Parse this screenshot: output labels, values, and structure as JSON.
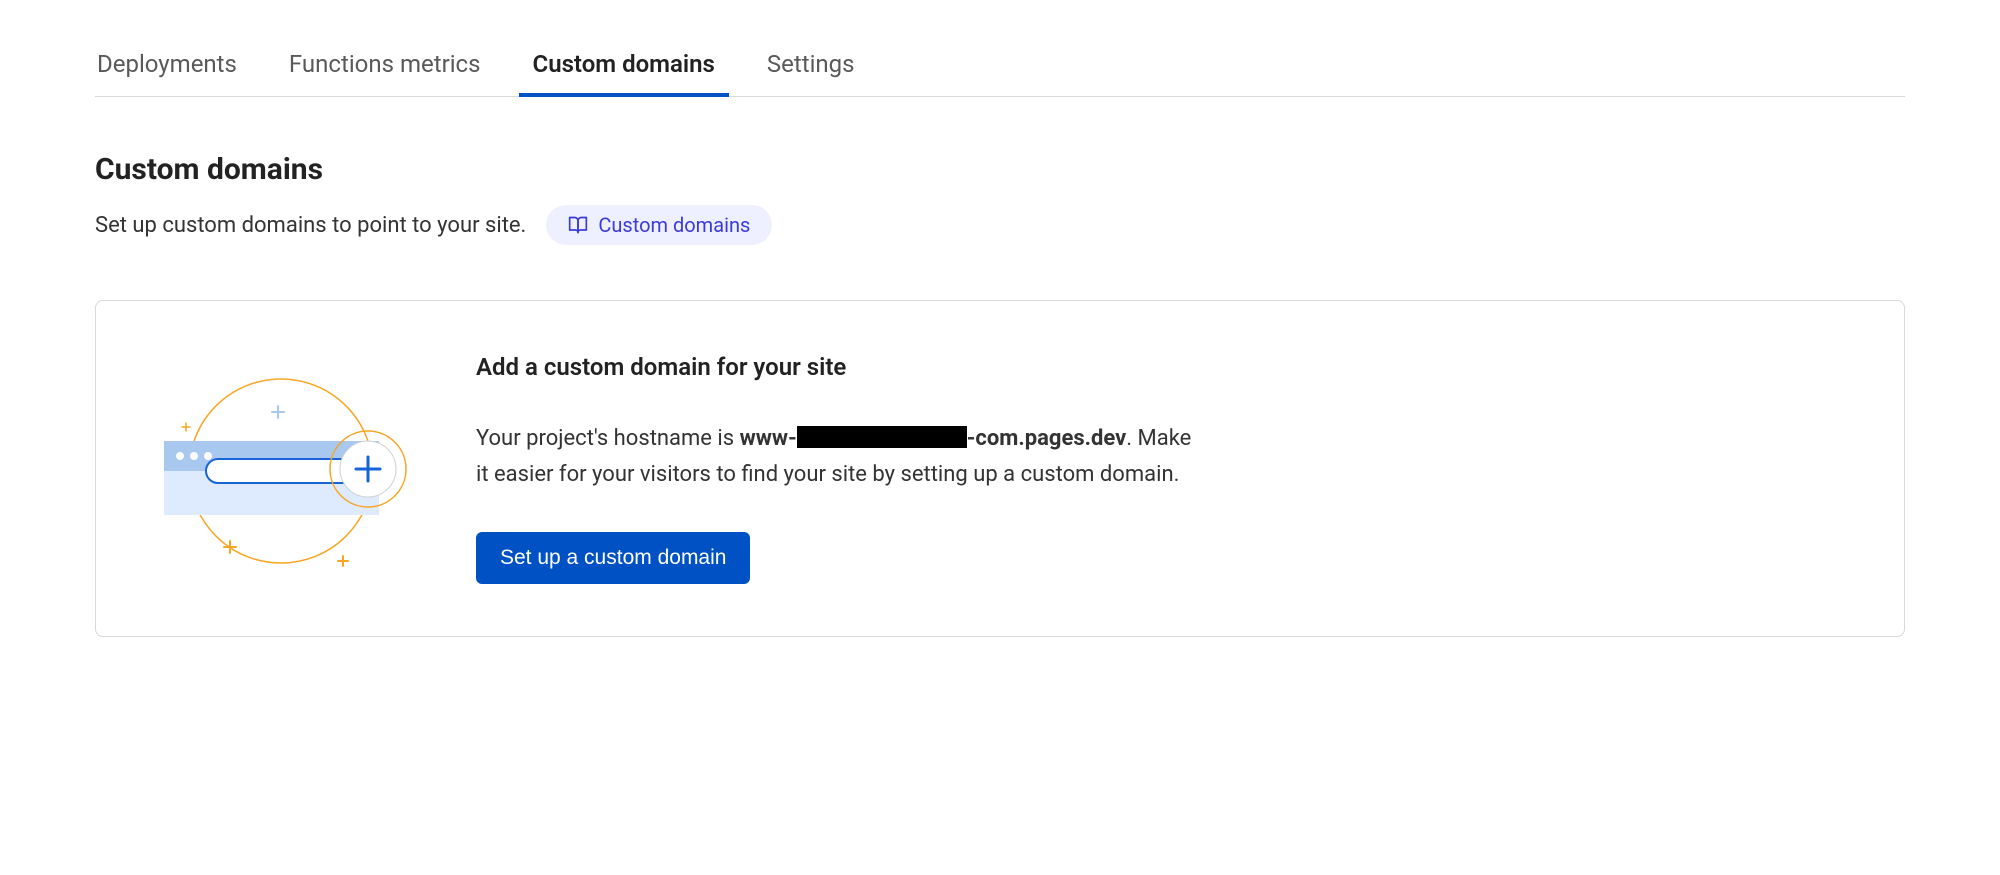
{
  "tabs": [
    {
      "label": "Deployments",
      "active": false
    },
    {
      "label": "Functions metrics",
      "active": false
    },
    {
      "label": "Custom domains",
      "active": true
    },
    {
      "label": "Settings",
      "active": false
    }
  ],
  "section": {
    "title": "Custom domains",
    "subtitle": "Set up custom domains to point to your site.",
    "doc_link_label": "Custom domains"
  },
  "card": {
    "title": "Add a custom domain for your site",
    "paragraph_prefix": "Your project's hostname is ",
    "hostname_prefix": "www-",
    "hostname_redacted": true,
    "hostname_suffix": "-com.pages.dev",
    "paragraph_suffix": ". Make it easier for your visitors to find your site by setting up a custom domain.",
    "button_label": "Set up a custom domain"
  }
}
